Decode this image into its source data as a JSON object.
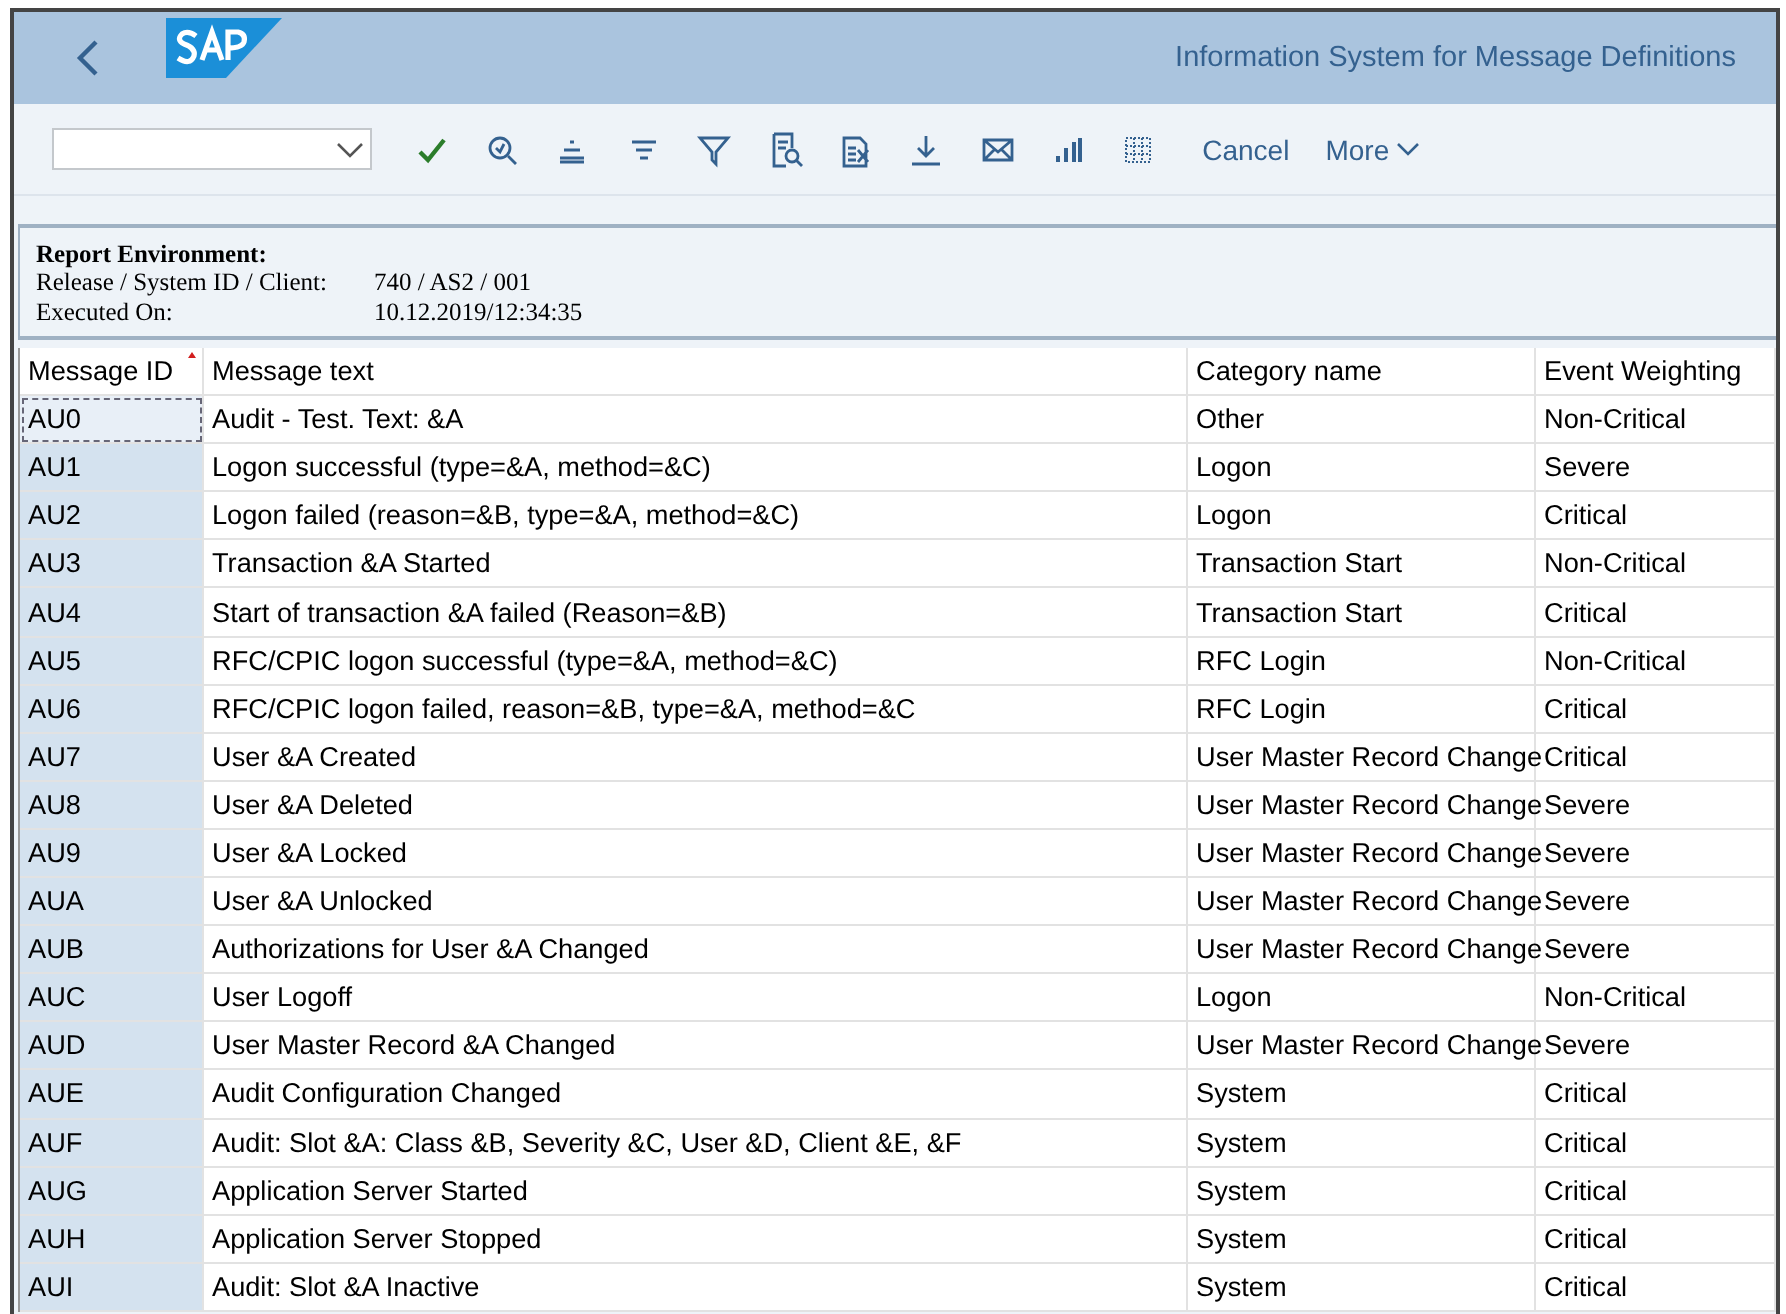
{
  "header": {
    "title": "Information System for Message Definitions"
  },
  "toolbar": {
    "buttons": [
      {
        "label": "Cancel",
        "kind": "text"
      },
      {
        "label": "More",
        "kind": "menu"
      }
    ]
  },
  "report_environment": {
    "heading": "Report Environment:",
    "lines": [
      {
        "label": "Release / System ID / Client:",
        "value": "740 / AS2 / 001"
      },
      {
        "label": "Executed On:",
        "value": "10.12.2019/12:34:35"
      }
    ]
  },
  "table": {
    "columns": [
      {
        "label": "Message ID",
        "sorted": true
      },
      {
        "label": "Message text",
        "sorted": false
      },
      {
        "label": "Category name",
        "sorted": false
      },
      {
        "label": "Event Weighting",
        "sorted": false
      }
    ],
    "rows": [
      {
        "cells": [
          "AU0",
          "Audit - Test. Text: &A",
          "Other",
          "Non-Critical"
        ],
        "focused": true
      },
      {
        "cells": [
          "AU1",
          "Logon successful (type=&A, method=&C)",
          "Logon",
          "Severe"
        ],
        "focused": false
      },
      {
        "cells": [
          "AU2",
          "Logon failed (reason=&B, type=&A, method=&C)",
          "Logon",
          "Critical"
        ],
        "focused": false
      },
      {
        "cells": [
          "AU3",
          "Transaction &A Started",
          "Transaction Start",
          "Non-Critical"
        ],
        "focused": false
      },
      {
        "cells": [
          "AU4",
          "Start of transaction &A failed (Reason=&B)",
          "Transaction Start",
          "Critical"
        ],
        "focused": false
      },
      {
        "cells": [
          "AU5",
          "RFC/CPIC logon successful (type=&A, method=&C)",
          "RFC Login",
          "Non-Critical"
        ],
        "focused": false
      },
      {
        "cells": [
          "AU6",
          "RFC/CPIC logon failed, reason=&B, type=&A, method=&C",
          "RFC Login",
          "Critical"
        ],
        "focused": false
      },
      {
        "cells": [
          "AU7",
          "User &A Created",
          "User Master Record Change",
          "Critical"
        ],
        "focused": false
      },
      {
        "cells": [
          "AU8",
          "User &A Deleted",
          "User Master Record Change",
          "Severe"
        ],
        "focused": false
      },
      {
        "cells": [
          "AU9",
          "User &A Locked",
          "User Master Record Change",
          "Severe"
        ],
        "focused": false
      },
      {
        "cells": [
          "AUA",
          "User &A Unlocked",
          "User Master Record Change",
          "Severe"
        ],
        "focused": false
      },
      {
        "cells": [
          "AUB",
          "Authorizations for User &A Changed",
          "User Master Record Change",
          "Severe"
        ],
        "focused": false
      },
      {
        "cells": [
          "AUC",
          "User Logoff",
          "Logon",
          "Non-Critical"
        ],
        "focused": false
      },
      {
        "cells": [
          "AUD",
          "User Master Record &A Changed",
          "User Master Record Change",
          "Severe"
        ],
        "focused": false
      },
      {
        "cells": [
          "AUE",
          "Audit Configuration Changed",
          "System",
          "Critical"
        ],
        "focused": false
      },
      {
        "cells": [
          "AUF",
          "Audit: Slot &A: Class &B, Severity &C, User &D, Client &E, &F",
          "System",
          "Critical"
        ],
        "focused": false
      },
      {
        "cells": [
          "AUG",
          "Application Server Started",
          "System",
          "Critical"
        ],
        "focused": false
      },
      {
        "cells": [
          "AUH",
          "Application Server Stopped",
          "System",
          "Critical"
        ],
        "focused": false
      },
      {
        "cells": [
          "AUI",
          "Audit: Slot &A Inactive",
          "System",
          "Critical"
        ],
        "focused": false
      }
    ]
  }
}
